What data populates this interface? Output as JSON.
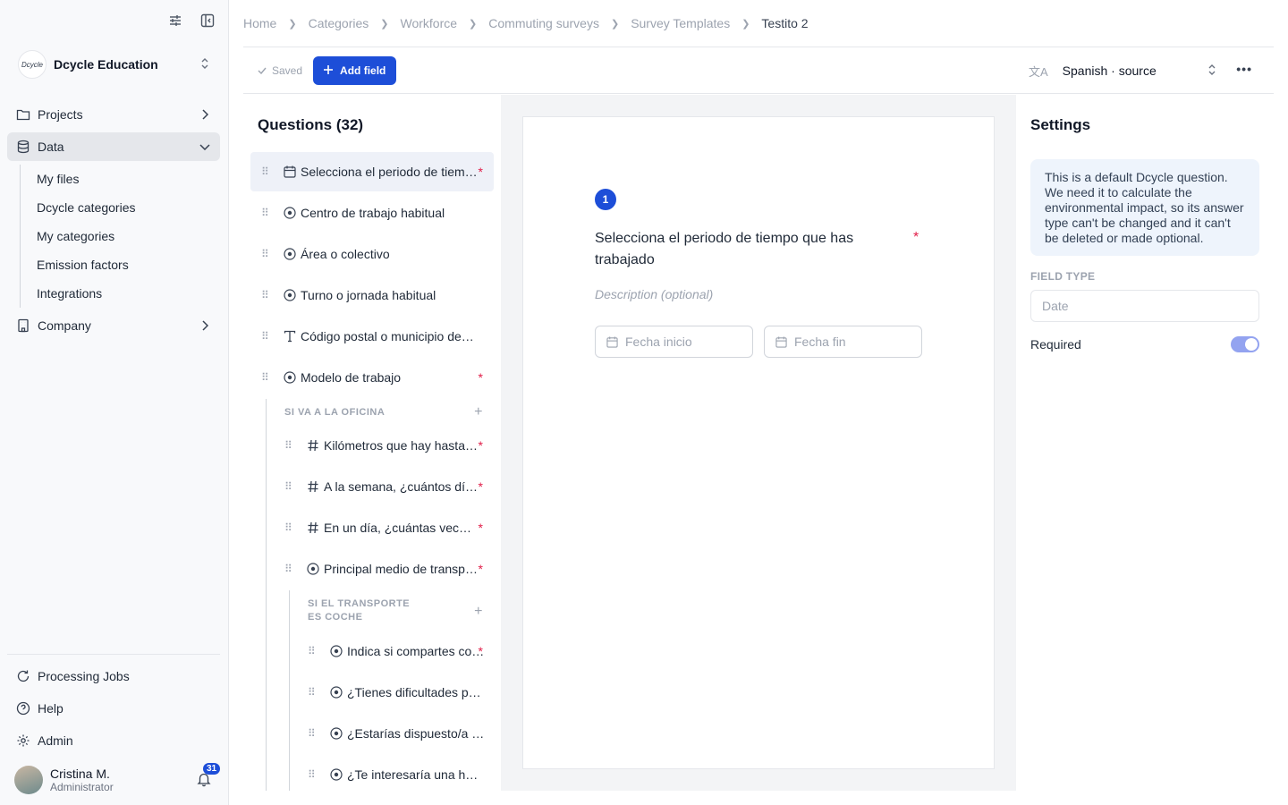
{
  "sidebar": {
    "org_logo_text": "Dcycle",
    "org_name": "Dcycle Education",
    "nav": [
      {
        "label": "Projects",
        "icon": "folder-icon"
      },
      {
        "label": "Data",
        "icon": "database-icon"
      },
      {
        "label": "Company",
        "icon": "building-icon"
      }
    ],
    "data_sub": [
      "My files",
      "Dcycle categories",
      "My categories",
      "Emission factors",
      "Integrations"
    ],
    "bottom": [
      {
        "label": "Processing Jobs",
        "icon": "refresh-icon"
      },
      {
        "label": "Help",
        "icon": "help-icon"
      },
      {
        "label": "Admin",
        "icon": "gear-icon"
      }
    ],
    "user": {
      "name": "Cristina M.",
      "role": "Administrator",
      "notifications": "31"
    }
  },
  "breadcrumb": [
    "Home",
    "Categories",
    "Workforce",
    "Commuting surveys",
    "Survey Templates",
    "Testito 2"
  ],
  "toolbar": {
    "saved_label": "Saved",
    "add_field_label": "Add field",
    "language_label": "Spanish · source"
  },
  "questions": {
    "title": "Questions (32)",
    "top_items": [
      {
        "label": "Selecciona el periodo de tiempo que has trabajado",
        "icon": "calendar-icon",
        "required": true
      },
      {
        "label": "Centro de trabajo habitual",
        "icon": "radio-icon",
        "required": false
      },
      {
        "label": "Área o colectivo",
        "icon": "radio-icon",
        "required": false
      },
      {
        "label": "Turno o jornada habitual",
        "icon": "radio-icon",
        "required": false
      },
      {
        "label": "Código postal o municipio desde el que te desplazas",
        "icon": "text-icon",
        "required": false
      },
      {
        "label": "Modelo de trabajo",
        "icon": "radio-icon",
        "required": true
      }
    ],
    "group1": {
      "title": "SI VA A LA OFICINA",
      "items": [
        {
          "label": "Kilómetros que hay hasta tu centro de trabajo",
          "icon": "hash-icon",
          "required": true
        },
        {
          "label": "A la semana, ¿cuántos días vas a la oficina?",
          "icon": "hash-icon",
          "required": true
        },
        {
          "label": "En un día, ¿cuántas veces haces el trayecto?",
          "icon": "hash-icon",
          "required": true
        },
        {
          "label": "Principal medio de transporte",
          "icon": "radio-icon",
          "required": true
        }
      ]
    },
    "group2": {
      "title": "SI EL TRANSPORTE ES COCHE",
      "items": [
        {
          "label": "Indica si compartes coche",
          "icon": "radio-icon",
          "required": true
        },
        {
          "label": "¿Tienes dificultades para aparcar?",
          "icon": "radio-icon",
          "required": false
        },
        {
          "label": "¿Estarías dispuesto/a a compartir coche?",
          "icon": "radio-icon",
          "required": false
        },
        {
          "label": "¿Te interesaría una herramienta para compartir coche?",
          "icon": "radio-icon",
          "required": false
        }
      ]
    }
  },
  "card": {
    "number": "1",
    "question": "Selecciona el periodo de tiempo que has trabajado",
    "required_mark": "*",
    "description_placeholder": "Description (optional)",
    "start_placeholder": "Fecha inicio",
    "end_placeholder": "Fecha fin"
  },
  "settings": {
    "title": "Settings",
    "info": "This is a default Dcycle question. We need it to calculate the environmental impact, so its answer type can't be changed and it can't be deleted or made optional.",
    "field_type_label": "FIELD TYPE",
    "field_type_value": "Date",
    "required_label": "Required",
    "required_on": true
  },
  "colors": {
    "accent": "#1d4ed8",
    "required": "#e11d48",
    "info_bg": "#eef4fc"
  }
}
